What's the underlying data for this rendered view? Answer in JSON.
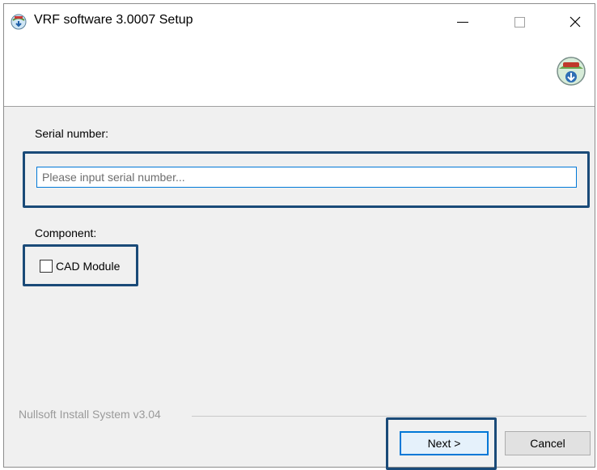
{
  "window": {
    "title": "VRF software 3.0007 Setup",
    "icon": "installer-globe-icon",
    "controls": {
      "minimize_icon": "minimize-icon",
      "maximize_icon": "maximize-icon",
      "close_glyph": "✕"
    }
  },
  "header": {
    "logo_icon": "installer-logo-icon"
  },
  "serial": {
    "label": "Serial number:",
    "value": "",
    "placeholder": "Please input serial number..."
  },
  "component": {
    "label": "Component:",
    "options": [
      {
        "label": "CAD Module",
        "checked": false
      }
    ]
  },
  "footer": {
    "branding": "Nullsoft Install System v3.04"
  },
  "buttons": {
    "next": "Next >",
    "cancel": "Cancel"
  },
  "colors": {
    "highlight": "#1a4a78",
    "focus_accent": "#0078d7",
    "dialog_bg": "#f0f0f0"
  }
}
